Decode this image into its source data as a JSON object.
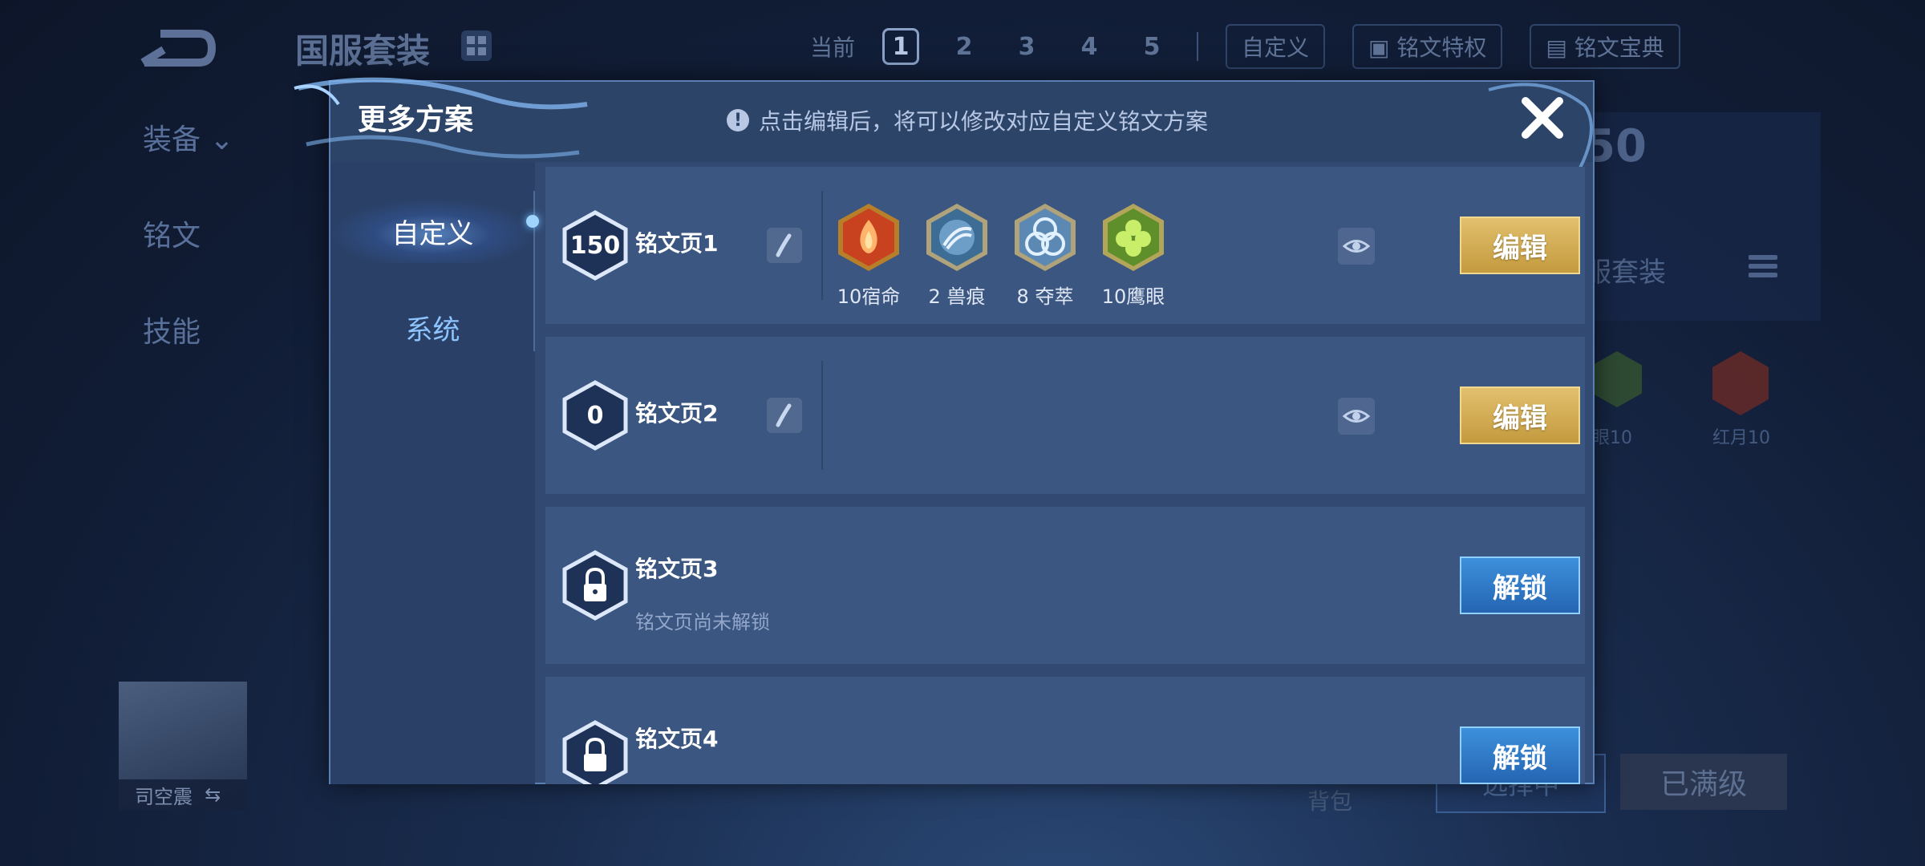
{
  "background": {
    "title": "国服套装",
    "tabs": {
      "current_label": "当前",
      "pages": [
        "1",
        "2",
        "3",
        "4",
        "5"
      ],
      "custom_label": "自定义"
    },
    "privilege_label": "铭文特权",
    "codex_label": "铭文宝典",
    "nav": [
      "装备",
      "铭文",
      "技能"
    ],
    "suit_badge": "50",
    "suit_label": "服套装",
    "rune_preview_labels": [
      "眼10",
      "红月10"
    ],
    "hero_name": "司空震",
    "bag_label": "背包",
    "select_button_label": "选择中",
    "max_level_label": "已满级"
  },
  "modal": {
    "title": "更多方案",
    "hint": "点击编辑后，将可以修改对应自定义铭文方案",
    "side_tabs": [
      {
        "label": "自定义",
        "active": true
      },
      {
        "label": "系统",
        "active": false
      }
    ],
    "pages": [
      {
        "level": "150",
        "name": "铭文页1",
        "locked": false,
        "action": "编辑",
        "runes": [
          {
            "label": "10宿命",
            "color": "#c8421f",
            "icon": "flame-rune-icon"
          },
          {
            "label": "2 兽痕",
            "color": "#6c9ec8",
            "icon": "claw-rune-icon"
          },
          {
            "label": "8 夺萃",
            "color": "#9bc0de",
            "icon": "knot-rune-icon"
          },
          {
            "label": "10鹰眼",
            "color": "#8cbd3a",
            "icon": "clover-rune-icon"
          }
        ]
      },
      {
        "level": "0",
        "name": "铭文页2",
        "locked": false,
        "action": "编辑",
        "runes": []
      },
      {
        "name": "铭文页3",
        "locked": true,
        "status": "铭文页尚未解锁",
        "action": "解锁"
      },
      {
        "name": "铭文页4",
        "locked": true,
        "action": "解锁"
      }
    ]
  }
}
